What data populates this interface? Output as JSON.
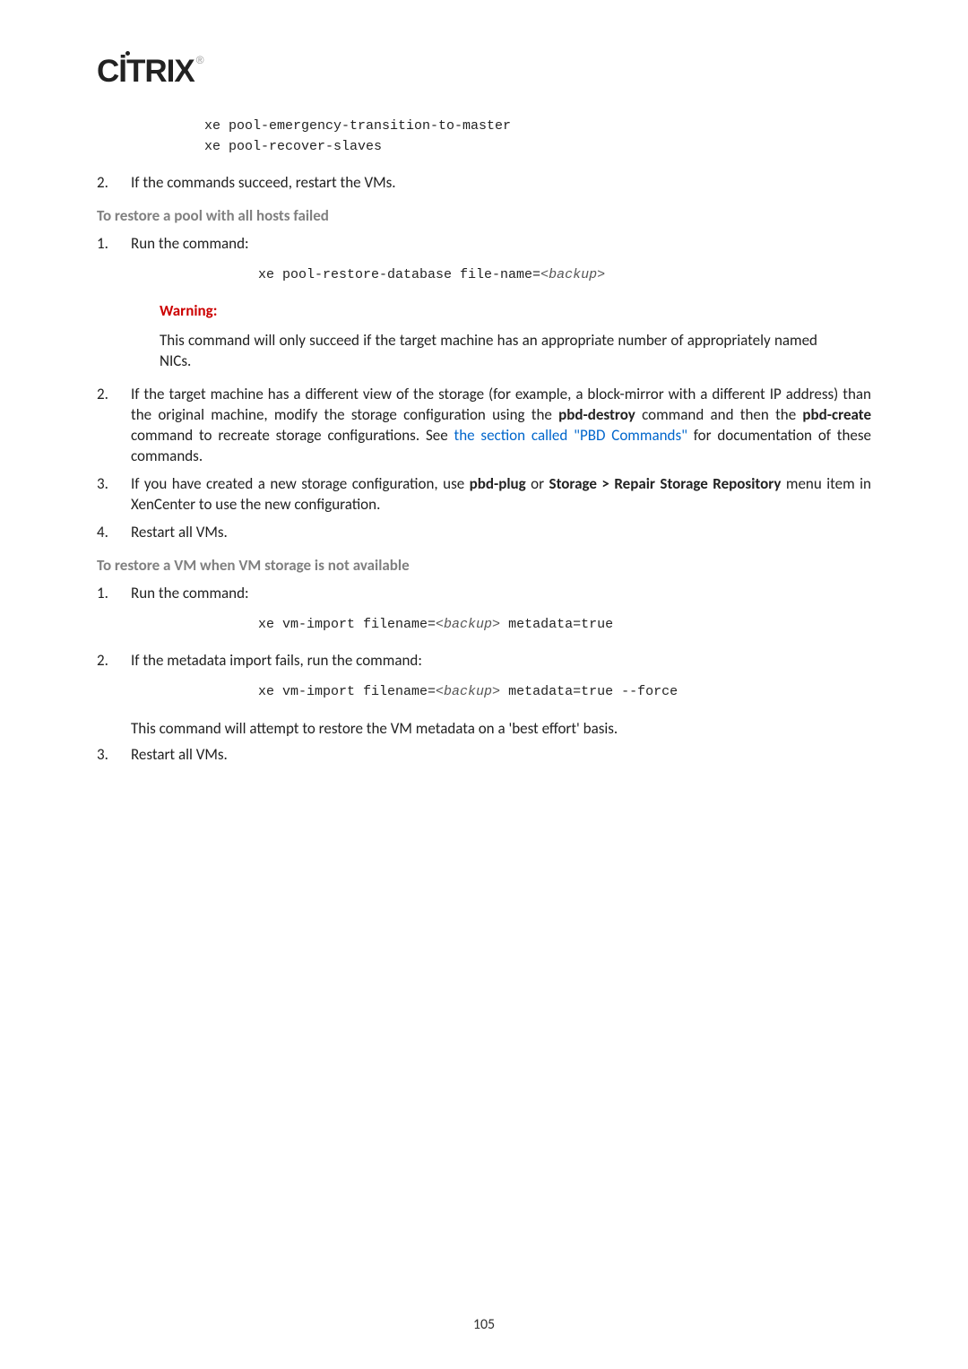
{
  "logo": {
    "text": "CİTRIX",
    "reg": "®"
  },
  "code1_line1": "xe pool-emergency-transition-to-master",
  "code1_line2": "xe pool-recover-slaves",
  "step2": "If the commands succeed, restart the VMs.",
  "heading1": "To restore a pool with all hosts failed",
  "runcmd": "Run the command:",
  "code2_prefix": "xe pool-restore-database file-name=",
  "code2_param": "<backup>",
  "warning_label": "Warning:",
  "warning_text": "This command will only succeed if the target machine has an appropriate number of appropriately named NICs.",
  "step2b_part1": "If the target machine has a different view of the storage (for example, a block-mirror with a different IP address) than the original machine, modify the storage configuration using the ",
  "step2b_bold1": "pbd-destroy",
  "step2b_part2": " command and then the ",
  "step2b_bold2": "pbd-create",
  "step2b_part3": " command to recreate storage configurations. See ",
  "step2b_link": "the section called \"PBD Commands\"",
  "step2b_part4": " for documentation of these commands.",
  "step3_part1": "If you have created a new storage configuration, use ",
  "step3_bold1": "pbd-plug",
  "step3_part2": " or ",
  "step3_bold2": "Storage > Repair Storage Repository",
  "step3_part3": " menu item in XenCenter to use the new configuration.",
  "step4": "Restart all VMs.",
  "heading2": "To restore a VM when VM storage is not available",
  "code3_prefix": "xe vm-import filename=",
  "code3_suffix": " metadata=true",
  "step2c": "If the metadata import fails, run the command:",
  "code4_prefix": "xe vm-import filename=",
  "code4_suffix": " metadata=true --force",
  "aftercode4": "This command will attempt to restore the VM metadata on a 'best effort' basis.",
  "step3b": "Restart all VMs.",
  "page_number": "105",
  "nums": {
    "n1": "1.",
    "n2": "2.",
    "n3": "3.",
    "n4": "4."
  }
}
